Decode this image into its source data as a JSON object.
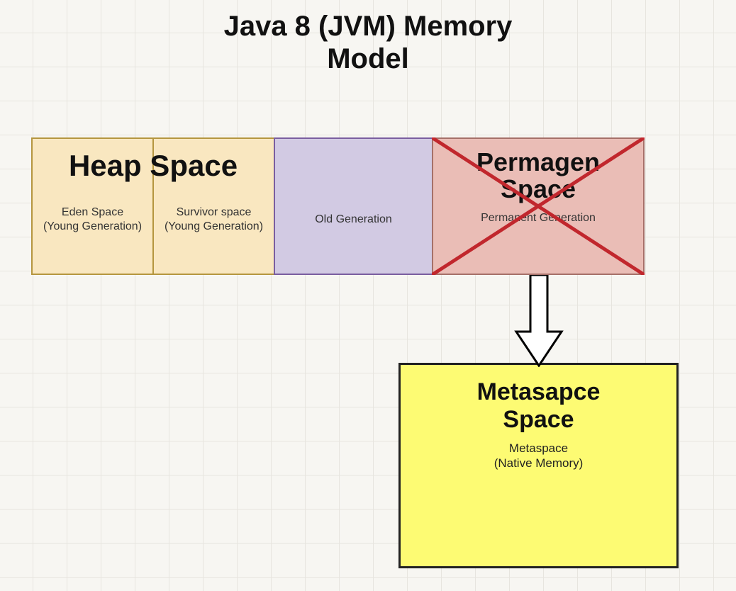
{
  "title_line1": "Java 8 (JVM) Memory",
  "title_line2": "Model",
  "heap_title": "Heap Space",
  "eden_line1": "Eden Space",
  "eden_line2": "(Young Generation)",
  "survivor_line1": "Survivor space",
  "survivor_line2": "(Young Generation)",
  "oldgen_label": "Old Generation",
  "permgen_title_line1": "Permagen",
  "permgen_title_line2": "Space",
  "permgen_sub": "Permanent Generation",
  "metaspace_title_line1": "Metasapce",
  "metaspace_title_line2": "Space",
  "metaspace_sub_line1": "Metaspace",
  "metaspace_sub_line2": "(Native Memory)"
}
